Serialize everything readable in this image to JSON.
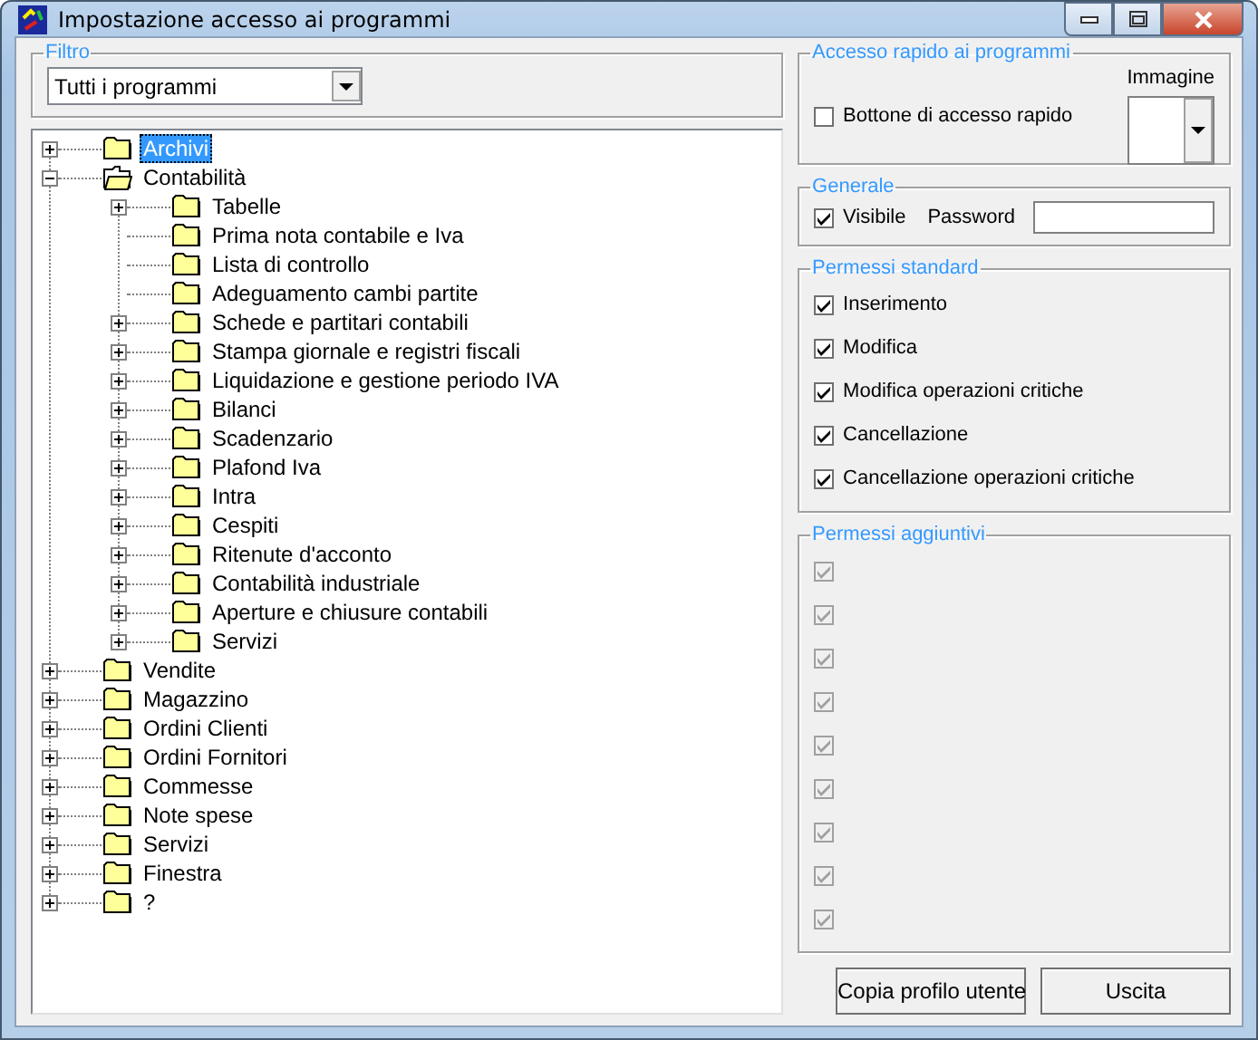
{
  "window": {
    "title": "Impostazione accesso ai programmi"
  },
  "filter": {
    "legend": "Filtro",
    "value": "Tutti i programmi"
  },
  "tree": {
    "items": [
      {
        "label": "Archivi",
        "selected": true,
        "expanded": false,
        "expandable": true
      },
      {
        "label": "Contabilità",
        "selected": false,
        "expanded": true,
        "expandable": true,
        "children": [
          {
            "label": "Tabelle",
            "selected": false,
            "expanded": false,
            "expandable": true
          },
          {
            "label": "Prima nota contabile e Iva",
            "selected": false,
            "expanded": false,
            "expandable": false
          },
          {
            "label": "Lista di controllo",
            "selected": false,
            "expanded": false,
            "expandable": false
          },
          {
            "label": "Adeguamento cambi partite",
            "selected": false,
            "expanded": false,
            "expandable": false
          },
          {
            "label": "Schede e partitari contabili",
            "selected": false,
            "expanded": false,
            "expandable": true
          },
          {
            "label": "Stampa giornale e registri fiscali",
            "selected": false,
            "expanded": false,
            "expandable": true
          },
          {
            "label": "Liquidazione e gestione periodo IVA",
            "selected": false,
            "expanded": false,
            "expandable": true
          },
          {
            "label": "Bilanci",
            "selected": false,
            "expanded": false,
            "expandable": true
          },
          {
            "label": "Scadenzario",
            "selected": false,
            "expanded": false,
            "expandable": true
          },
          {
            "label": "Plafond Iva",
            "selected": false,
            "expanded": false,
            "expandable": true
          },
          {
            "label": "Intra",
            "selected": false,
            "expanded": false,
            "expandable": true
          },
          {
            "label": "Cespiti",
            "selected": false,
            "expanded": false,
            "expandable": true
          },
          {
            "label": "Ritenute d'acconto",
            "selected": false,
            "expanded": false,
            "expandable": true
          },
          {
            "label": "Contabilità industriale",
            "selected": false,
            "expanded": false,
            "expandable": true
          },
          {
            "label": "Aperture e chiusure contabili",
            "selected": false,
            "expanded": false,
            "expandable": true
          },
          {
            "label": "Servizi",
            "selected": false,
            "expanded": false,
            "expandable": true
          }
        ]
      },
      {
        "label": "Vendite",
        "selected": false,
        "expanded": false,
        "expandable": true
      },
      {
        "label": "Magazzino",
        "selected": false,
        "expanded": false,
        "expandable": true
      },
      {
        "label": "Ordini Clienti",
        "selected": false,
        "expanded": false,
        "expandable": true
      },
      {
        "label": "Ordini Fornitori",
        "selected": false,
        "expanded": false,
        "expandable": true
      },
      {
        "label": "Commesse",
        "selected": false,
        "expanded": false,
        "expandable": true
      },
      {
        "label": "Note spese",
        "selected": false,
        "expanded": false,
        "expandable": true
      },
      {
        "label": "Servizi",
        "selected": false,
        "expanded": false,
        "expandable": true
      },
      {
        "label": "Finestra",
        "selected": false,
        "expanded": false,
        "expandable": true
      },
      {
        "label": "?",
        "selected": false,
        "expanded": false,
        "expandable": true
      }
    ]
  },
  "quick_access": {
    "legend": "Accesso rapido ai programmi",
    "checkbox": {
      "label": "Bottone di accesso rapido",
      "checked": false
    },
    "image_label": "Immagine"
  },
  "general": {
    "legend": "Generale",
    "visible": {
      "label": "Visibile",
      "checked": true
    },
    "password_label": "Password"
  },
  "standard_permissions": {
    "legend": "Permessi standard",
    "items": [
      {
        "label": "Inserimento",
        "checked": true
      },
      {
        "label": "Modifica",
        "checked": true
      },
      {
        "label": "Modifica operazioni critiche",
        "checked": true
      },
      {
        "label": "Cancellazione",
        "checked": true
      },
      {
        "label": "Cancellazione operazioni critiche",
        "checked": true
      }
    ]
  },
  "additional_permissions": {
    "legend": "Permessi aggiuntivi",
    "items": [
      {
        "checked": true,
        "disabled": true
      },
      {
        "checked": true,
        "disabled": true
      },
      {
        "checked": true,
        "disabled": true
      },
      {
        "checked": true,
        "disabled": true
      },
      {
        "checked": true,
        "disabled": true
      },
      {
        "checked": true,
        "disabled": true
      },
      {
        "checked": true,
        "disabled": true
      },
      {
        "checked": true,
        "disabled": true
      },
      {
        "checked": true,
        "disabled": true
      }
    ]
  },
  "buttons": [
    "Copia profilo utente",
    "Uscita"
  ]
}
